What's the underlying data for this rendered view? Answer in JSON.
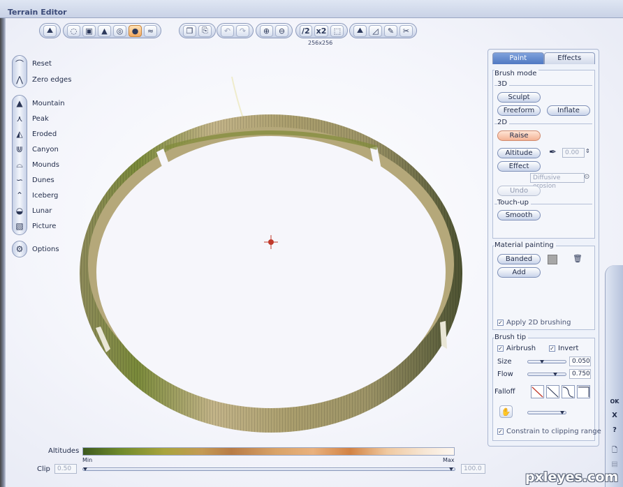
{
  "window": {
    "title": "Terrain Editor"
  },
  "toolbar": {
    "groups": [
      {
        "icons": [
          "terrain-select-icon"
        ]
      },
      {
        "icons": [
          "lasso-icon",
          "stamp-icon",
          "mountain-brush-icon",
          "sphere-outline-icon",
          "sphere-solid-icon",
          "water-icon"
        ]
      },
      {
        "icons": [
          "copy-icon",
          "paste-icon"
        ]
      },
      {
        "icons": [
          "undo-icon",
          "redo-icon"
        ]
      },
      {
        "icons": [
          "zoom-in-icon",
          "zoom-out-icon"
        ]
      },
      {
        "icons": [
          "half-resolution-icon",
          "double-resolution-icon",
          "crop-icon"
        ]
      },
      {
        "icons": [
          "terrain-tool-1-icon",
          "terrain-tool-2-icon",
          "terrain-tool-3-icon",
          "terrain-tool-4-icon"
        ]
      }
    ],
    "half_res_label": "/2",
    "double_res_label": "x2",
    "resolution": "256x256"
  },
  "left_tools": {
    "reset": "Reset",
    "zero_edges": "Zero edges",
    "presets": [
      "Mountain",
      "Peak",
      "Eroded",
      "Canyon",
      "Mounds",
      "Dunes",
      "Iceberg",
      "Lunar",
      "Picture"
    ],
    "options": "Options"
  },
  "right_panel": {
    "tabs": {
      "paint": "Paint",
      "effects": "Effects"
    },
    "brush_mode": {
      "title": "Brush mode",
      "label_3d": "3D",
      "sculpt": "Sculpt",
      "freeform": "Freeform",
      "inflate": "Inflate",
      "label_2d": "2D",
      "raise": "Raise",
      "altitude": "Altitude",
      "altitude_value": "0.00",
      "effect": "Effect",
      "effect_option": "Diffusive erosion",
      "undo": "Undo",
      "touchup_label": "Touch-up",
      "smooth": "Smooth"
    },
    "material": {
      "title": "Material painting",
      "banded": "Banded",
      "add": "Add",
      "apply_2d": "Apply 2D brushing",
      "swatch_color": "#a7a7a7"
    },
    "brush_tip": {
      "title": "Brush tip",
      "airbrush": "Airbrush",
      "invert": "Invert",
      "size_label": "Size",
      "size_value": "0.050",
      "size_level": 0.35,
      "flow_label": "Flow",
      "flow_value": "0.750",
      "flow_level": 0.75,
      "falloff_label": "Falloff",
      "constrain": "Constrain to clipping range"
    }
  },
  "side_buttons": {
    "ok": "OK",
    "close": "X",
    "help": "?"
  },
  "bottom": {
    "altitudes_label": "Altitudes",
    "min_label": "Min",
    "max_label": "Max",
    "clip_label": "Clip",
    "clip_min": "0.50",
    "clip_max": "100.0"
  },
  "colors": {
    "accent": "#4f78c2",
    "raise_highlight": "#f4b294",
    "crosshair": "#c0392b",
    "terrain_wall": "#b6a679"
  },
  "watermark": "pxleyes.com"
}
